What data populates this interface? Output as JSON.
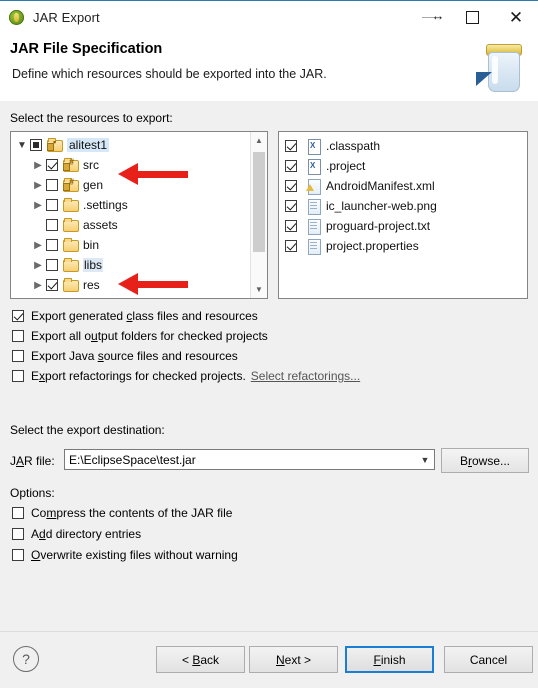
{
  "window": {
    "title": "JAR Export",
    "icon": "jar-export-icon",
    "controls": {
      "resize": "resize-horizontal-cursor",
      "minimize": "minimize-icon",
      "maximize": "maximize-icon",
      "close": "close-icon"
    }
  },
  "header": {
    "title": "JAR File Specification",
    "subtitle": "Define which resources should be exported into the JAR.",
    "banner_icon": "jar-banner-icon"
  },
  "resources": {
    "label": "Select the resources to export:",
    "tree": [
      {
        "name": "alitest1",
        "indent": 0,
        "twisty": "open",
        "check": "grayfill",
        "icon": "project-icon",
        "selected": true,
        "highlight": false
      },
      {
        "name": "src",
        "indent": 1,
        "twisty": "closed",
        "check": "checked",
        "icon": "package-icon",
        "selected": false,
        "highlight": false
      },
      {
        "name": "gen",
        "indent": 1,
        "twisty": "closed",
        "check": "none",
        "icon": "package-icon",
        "selected": false,
        "highlight": false
      },
      {
        "name": ".settings",
        "indent": 1,
        "twisty": "closed",
        "check": "none",
        "icon": "folder-icon",
        "selected": false,
        "highlight": false
      },
      {
        "name": "assets",
        "indent": 1,
        "twisty": "none",
        "check": "none",
        "icon": "folder-icon",
        "selected": false,
        "highlight": false
      },
      {
        "name": "bin",
        "indent": 1,
        "twisty": "closed",
        "check": "none",
        "icon": "folder-icon",
        "selected": false,
        "highlight": false
      },
      {
        "name": "libs",
        "indent": 1,
        "twisty": "closed",
        "check": "none",
        "icon": "folder-icon",
        "selected": false,
        "highlight": true
      },
      {
        "name": "res",
        "indent": 1,
        "twisty": "closed",
        "check": "checked",
        "icon": "folder-icon",
        "selected": false,
        "highlight": false
      }
    ],
    "files": [
      {
        "name": ".classpath",
        "check": "checked",
        "icon": "xml-file-icon"
      },
      {
        "name": ".project",
        "check": "checked",
        "icon": "xml-file-icon"
      },
      {
        "name": "AndroidManifest.xml",
        "check": "checked",
        "icon": "android-manifest-icon"
      },
      {
        "name": "ic_launcher-web.png",
        "check": "checked",
        "icon": "document-icon"
      },
      {
        "name": "proguard-project.txt",
        "check": "checked",
        "icon": "document-icon"
      },
      {
        "name": "project.properties",
        "check": "checked",
        "icon": "document-icon"
      }
    ],
    "scrollbar": {
      "up": "chevron-up-icon",
      "down": "chevron-down-icon"
    }
  },
  "export_options": [
    {
      "pre": "Export generated ",
      "mnemonic": "c",
      "post": "lass files and resources",
      "checked": true
    },
    {
      "pre": "Export all o",
      "mnemonic": "u",
      "post": "tput folders for checked projects",
      "checked": false
    },
    {
      "pre": "Export Java ",
      "mnemonic": "s",
      "post": "ource files and resources",
      "checked": false
    },
    {
      "pre": "E",
      "mnemonic": "x",
      "post": "port refactorings for checked projects.",
      "checked": false,
      "link": "Select refactorings..."
    }
  ],
  "destination": {
    "label": "Select the export destination:",
    "field_pre": "J",
    "field_mnemonic": "A",
    "field_post": "R file:",
    "value": "E:\\EclipseSpace\\test.jar",
    "placeholder": "",
    "dropdown_icon": "chevron-down-icon",
    "browse_pre": "B",
    "browse_mnemonic": "r",
    "browse_post": "owse..."
  },
  "options": {
    "label": "Options:",
    "items": [
      {
        "pre": "Co",
        "mnemonic": "m",
        "post": "press the contents of the JAR file",
        "checked": false
      },
      {
        "pre": "A",
        "mnemonic": "d",
        "post": "d directory entries",
        "checked": false
      },
      {
        "pre": "",
        "mnemonic": "O",
        "post": "verwrite existing files without warning",
        "checked": false
      }
    ]
  },
  "footer": {
    "help_icon": "help-icon",
    "buttons": [
      {
        "pre": "< ",
        "mnemonic": "B",
        "post": "ack",
        "default": false
      },
      {
        "pre": "",
        "mnemonic": "N",
        "post": "ext >",
        "default": false
      },
      {
        "pre": "",
        "mnemonic": "F",
        "post": "inish",
        "default": true
      },
      {
        "pre": "Cancel",
        "mnemonic": "",
        "post": "",
        "default": false
      }
    ]
  },
  "annotations": [
    {
      "name": "arrow-pointing-to-src",
      "target": "src"
    },
    {
      "name": "arrow-pointing-to-res",
      "target": "res"
    }
  ],
  "colors": {
    "accent": "#1a7fd4",
    "annotation": "#e8201a",
    "selection": "#d6e8f7",
    "panel_bg": "#f0f0f0"
  }
}
